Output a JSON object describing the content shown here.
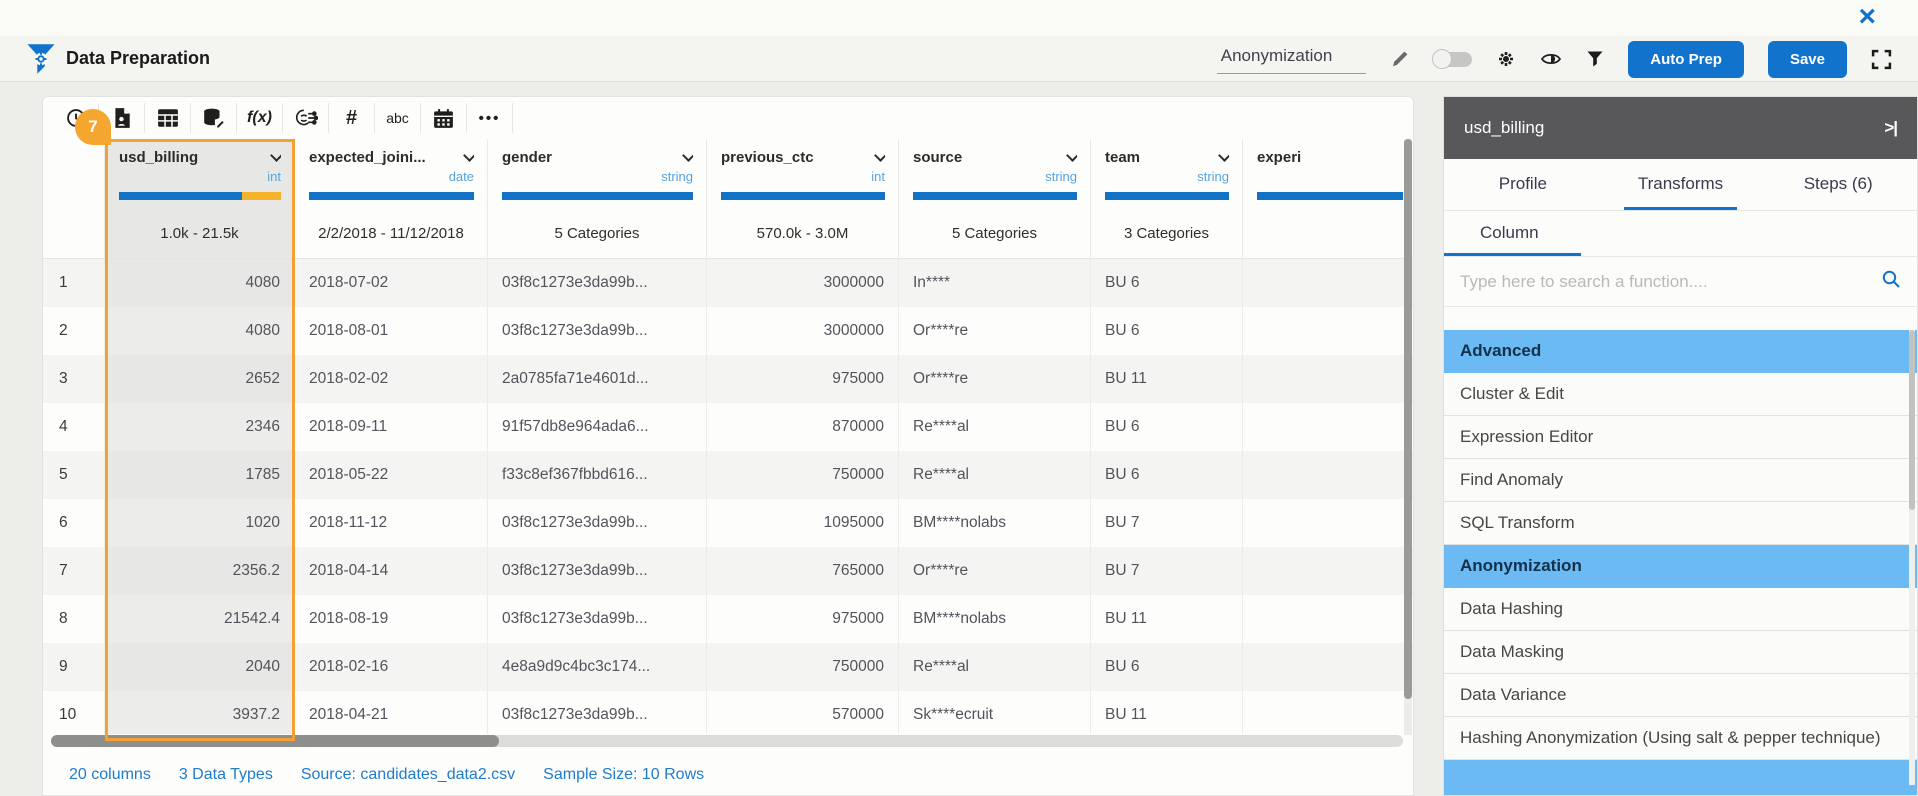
{
  "window": {
    "close_glyph": "×"
  },
  "app_bar": {
    "title": "Data Preparation",
    "prep_name": "Anonymization",
    "auto_prep_label": "Auto Prep",
    "save_label": "Save"
  },
  "toolbar": {
    "fx_label": "f(x)",
    "hash_label": "#",
    "abc_label": "abc",
    "more_label": "•••",
    "icon_names": [
      "history-icon",
      "file-icon",
      "table-icon",
      "database-edit-icon",
      "function-icon",
      "ai-transform-icon",
      "number-icon",
      "text-icon",
      "calendar-icon",
      "more-icon"
    ]
  },
  "table": {
    "selected_badge": "7",
    "selected_column": "usd_billing",
    "columns": [
      {
        "name": "usd_billing",
        "type": "int",
        "summary": "1.0k - 21.5k",
        "selected": true
      },
      {
        "name": "expected_joini...",
        "type": "date",
        "summary": "2/2/2018 - 11/12/2018"
      },
      {
        "name": "gender",
        "type": "string",
        "summary": "5 Categories"
      },
      {
        "name": "previous_ctc",
        "type": "int",
        "summary": "570.0k - 3.0M"
      },
      {
        "name": "source",
        "type": "string",
        "summary": "5 Categories"
      },
      {
        "name": "team",
        "type": "string",
        "summary": "3 Categories"
      },
      {
        "name": "experi",
        "type": "",
        "summary": ""
      }
    ],
    "rows": [
      [
        "1",
        "4080",
        "2018-07-02",
        "03f8c1273e3da99b...",
        "3000000",
        "In****",
        "BU 6",
        ""
      ],
      [
        "2",
        "4080",
        "2018-08-01",
        "03f8c1273e3da99b...",
        "3000000",
        "Or****re",
        "BU 6",
        ""
      ],
      [
        "3",
        "2652",
        "2018-02-02",
        "2a0785fa71e4601d...",
        "975000",
        "Or****re",
        "BU 11",
        ""
      ],
      [
        "4",
        "2346",
        "2018-09-11",
        "91f57db8e964ada6...",
        "870000",
        "Re****al",
        "BU 6",
        ""
      ],
      [
        "5",
        "1785",
        "2018-05-22",
        "f33c8ef367fbbd616...",
        "750000",
        "Re****al",
        "BU 6",
        ""
      ],
      [
        "6",
        "1020",
        "2018-11-12",
        "03f8c1273e3da99b...",
        "1095000",
        "BM****nolabs",
        "BU 7",
        ""
      ],
      [
        "7",
        "2356.2",
        "2018-04-14",
        "03f8c1273e3da99b...",
        "765000",
        "Or****re",
        "BU 7",
        ""
      ],
      [
        "8",
        "21542.4",
        "2018-08-19",
        "03f8c1273e3da99b...",
        "975000",
        "BM****nolabs",
        "BU 11",
        ""
      ],
      [
        "9",
        "2040",
        "2018-02-16",
        "4e8a9d9c4bc3c174...",
        "750000",
        "Re****al",
        "BU 6",
        ""
      ],
      [
        "10",
        "3937.2",
        "2018-04-21",
        "03f8c1273e3da99b...",
        "570000",
        "Sk****ecruit",
        "BU 11",
        ""
      ]
    ]
  },
  "status_bar": {
    "columns": "20 columns",
    "data_types": "3 Data Types",
    "source": "Source: candidates_data2.csv",
    "sample_size": "Sample Size: 10 Rows"
  },
  "panel": {
    "column_name": "usd_billing",
    "collapse_glyph": ">|",
    "tabs": [
      "Profile",
      "Transforms",
      "Steps (6)"
    ],
    "active_tab": "Transforms",
    "sub_tab": "Column",
    "search_placeholder": "Type here to search a function....",
    "items": [
      {
        "label": "Advanced",
        "highlighted": true
      },
      {
        "label": "Cluster & Edit",
        "highlighted": false
      },
      {
        "label": "Expression Editor",
        "highlighted": false
      },
      {
        "label": "Find Anomaly",
        "highlighted": false
      },
      {
        "label": "SQL Transform",
        "highlighted": false
      },
      {
        "label": "Anonymization",
        "highlighted": true
      },
      {
        "label": "Data Hashing",
        "highlighted": false
      },
      {
        "label": "Data Masking",
        "highlighted": false
      },
      {
        "label": "Data Variance",
        "highlighted": false
      },
      {
        "label": "Hashing Anonymization (Using salt & pepper technique)",
        "highlighted": false
      },
      {
        "label": "",
        "highlighted": true
      }
    ]
  },
  "colors": {
    "accent_blue": "#1273cc",
    "bar_blue": "#1273c4",
    "type_blue": "#55a4e0",
    "highlight_blue": "#6cbaf3",
    "selection_orange": "#f0a232",
    "badge_orange": "#f5a62e",
    "panel_header_gray": "#58585a"
  }
}
